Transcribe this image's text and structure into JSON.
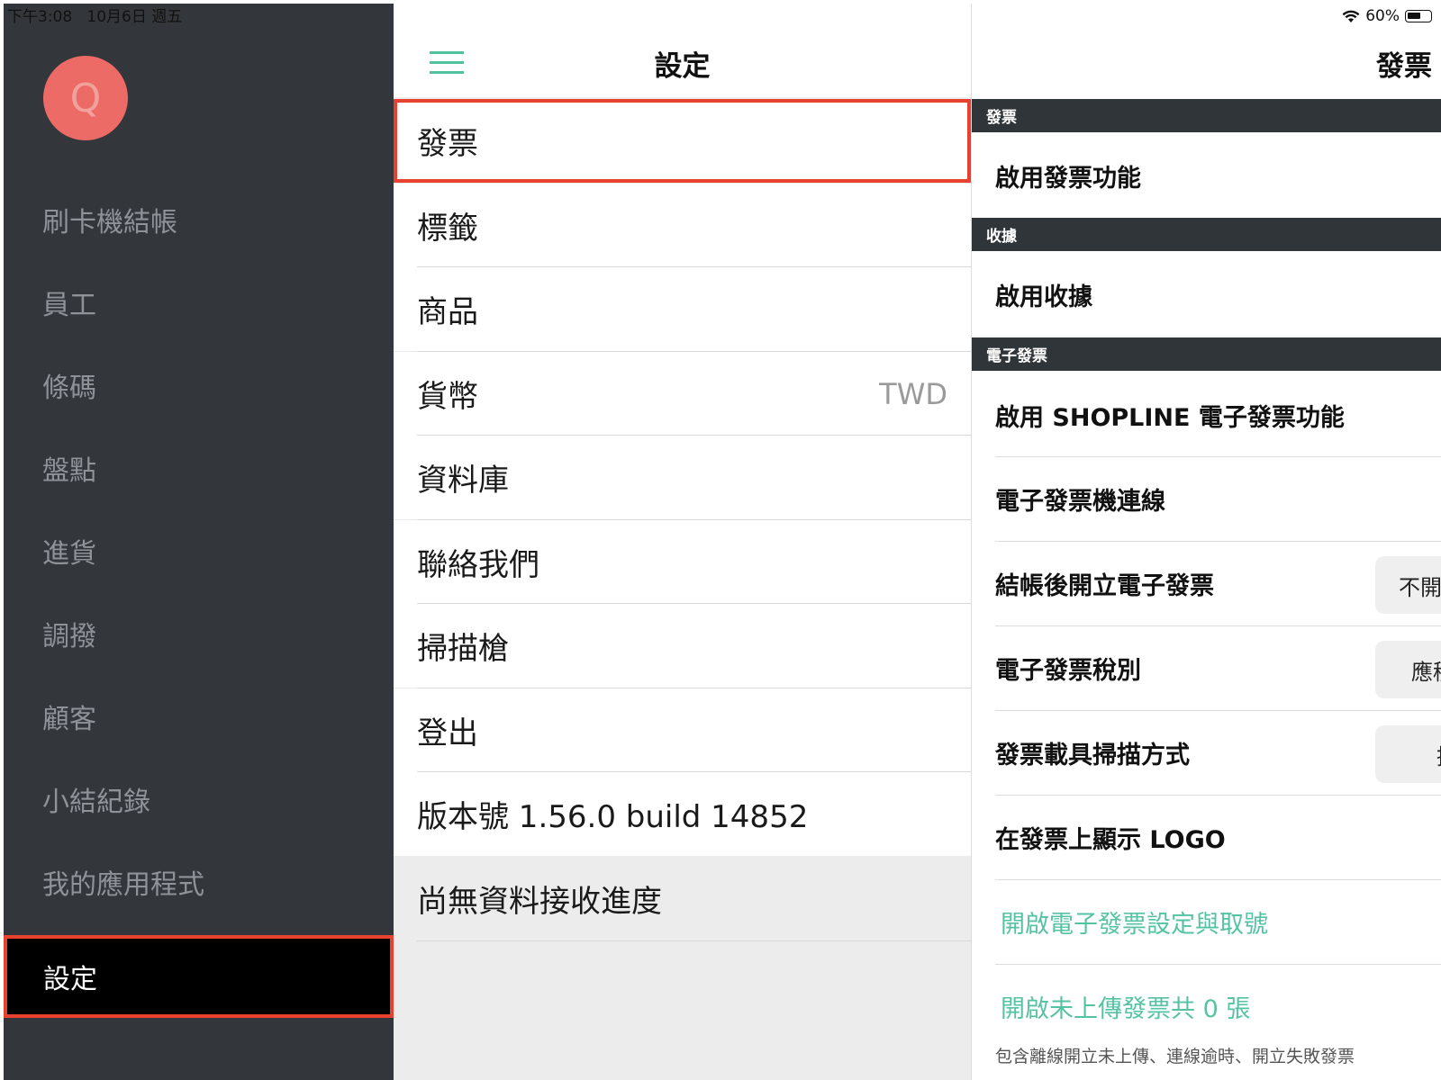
{
  "status_bar": {
    "time": "下午3:08",
    "date": "10月6日 週五",
    "battery": "60%",
    "battery_level": 0.6
  },
  "sidebar": {
    "avatar_letter": "Q",
    "items": [
      {
        "label": "刷卡機結帳"
      },
      {
        "label": "員工"
      },
      {
        "label": "條碼"
      },
      {
        "label": "盤點"
      },
      {
        "label": "進貨"
      },
      {
        "label": "調撥"
      },
      {
        "label": "顧客"
      },
      {
        "label": "小結紀錄"
      },
      {
        "label": "我的應用程式"
      },
      {
        "label": "設定"
      }
    ]
  },
  "settings": {
    "title": "設定",
    "items": [
      {
        "label": "發票"
      },
      {
        "label": "標籤"
      },
      {
        "label": "商品"
      },
      {
        "label": "貨幣",
        "value": "TWD"
      },
      {
        "label": "資料庫"
      },
      {
        "label": "聯絡我們"
      },
      {
        "label": "掃描槍"
      },
      {
        "label": "登出"
      },
      {
        "label": "版本號 1.56.0   build 14852"
      },
      {
        "label": "尚無資料接收進度"
      }
    ]
  },
  "invoice": {
    "title": "發票",
    "sections": {
      "invoice": "發票",
      "receipt": "收據",
      "e_invoice": "電子發票"
    },
    "rows": {
      "enable_invoice": "啟用發票功能",
      "enable_receipt": "啟用收據",
      "enable_shopline": "啟用 SHOPLINE 電子發票功能",
      "printer_connect": "電子發票機連線",
      "issue_after_checkout": "結帳後開立電子發票",
      "issue_after_checkout_value": "不開",
      "tax_type": "電子發票稅別",
      "tax_type_value": "應稅",
      "carrier_scan": "發票載具掃描方式",
      "carrier_scan_value": "掃",
      "show_logo": "在發票上顯示 LOGO",
      "open_settings": "開啟電子發票設定與取號",
      "open_pending": "開啟未上傳發票共 0 張",
      "note": "包含離線開立未上傳、連線逾時、開立失敗發票"
    }
  },
  "colors": {
    "sidebar_bg": "#33363b",
    "accent_green": "#51c1a0",
    "highlight_red": "#e8412f",
    "avatar_bg": "#ec6b67",
    "section_header_bg": "#30353a"
  }
}
